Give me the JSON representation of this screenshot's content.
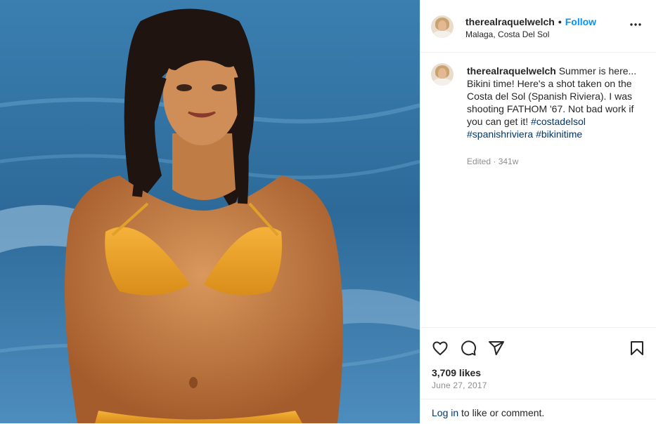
{
  "post": {
    "username": "therealraquelwelch",
    "follow_label": "Follow",
    "separator": "•",
    "location": "Malaga, Costa Del Sol",
    "more_icon": "more-horizontal-icon",
    "caption": {
      "username": "therealraquelwelch",
      "text": " Summer is here... Bikini time! Here's a shot taken on the Costa del Sol (Spanish Riviera). I was shooting FATHOM '67. Not bad work if you can get it!",
      "hashtags": [
        "#costadelsol",
        "#spanishriviera",
        "#bikinitime"
      ],
      "edited": "Edited",
      "age": "341w"
    },
    "likes": "3,709 likes",
    "date": "June 27, 2017",
    "login_link": "Log in",
    "login_text": " to like or comment."
  },
  "icons": [
    "heart-icon",
    "comment-icon",
    "share-icon",
    "bookmark-icon"
  ],
  "colors": {
    "link": "#00376b",
    "follow": "#0095f6",
    "muted": "#8e8e8e"
  }
}
